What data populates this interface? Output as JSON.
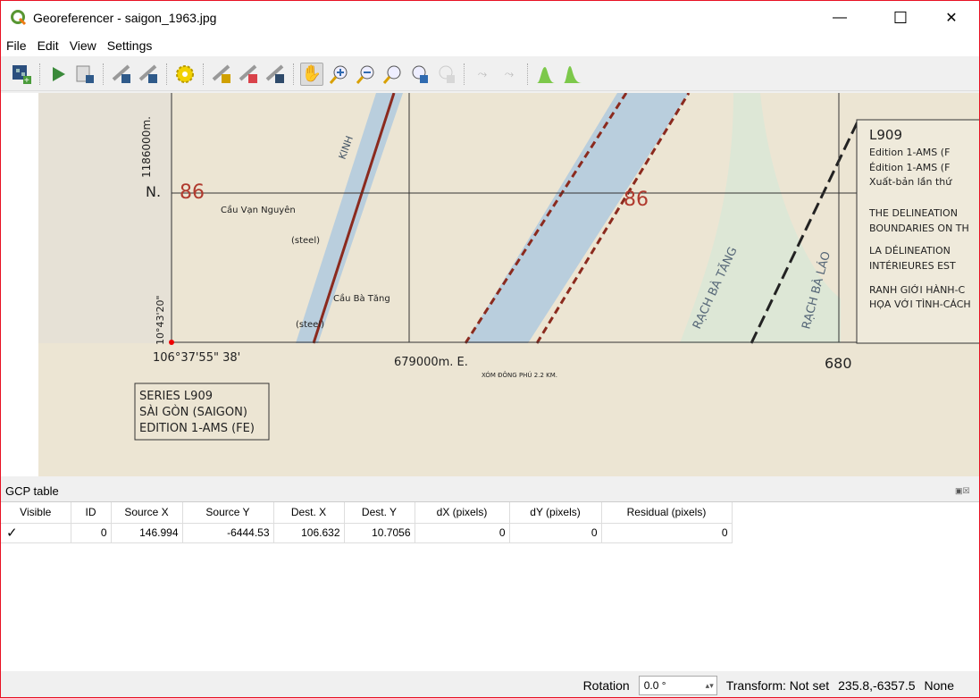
{
  "window": {
    "title": "Georeferencer - saigon_1963.jpg",
    "minimize": "—",
    "maximize": "☐",
    "close": "✕"
  },
  "menu": [
    "File",
    "Edit",
    "View",
    "Settings"
  ],
  "toolbar": [
    "open-raster",
    "start-georeferencing",
    "generate-gdal-script",
    "load-gcp-points",
    "save-gcp-points",
    "transformation-settings",
    "add-point",
    "delete-point",
    "move-gcp-point",
    "pan",
    "zoom-in",
    "zoom-out",
    "zoom-to-layer",
    "zoom-last",
    "zoom-next",
    "link-georeferencer-to-qgis",
    "link-qgis-to-georeferencer",
    "full-histogram-stretch",
    "local-histogram-stretch"
  ],
  "map": {
    "labels": [
      "86",
      "86",
      "N.",
      "Cầu Vạn Nguyên",
      "(steel)",
      "Cầu Bà Tăng",
      "(steel)",
      "10°43'20\"",
      "1186000m.",
      "106°37'55\" 38'",
      "679000m. E.",
      "680",
      "XÓM ĐÔNG PHÚ 2.2 KM.",
      "KINH",
      "RẠCH BÀ TĂNG",
      "RẠCH BÀ LÁO"
    ],
    "legend_box": [
      "SERIES L909",
      "SÀI GÒN (SAIGON)",
      "EDITION 1-AMS (FE)"
    ],
    "info_box": [
      "L909",
      "Edition 1-AMS (F",
      "Édition 1-AMS (F",
      "Xuất-bản lần thứ",
      "THE DELINEATION",
      "BOUNDARIES ON TH",
      "LA DÉLINEATION",
      "INTÉRIEURES EST",
      "RANH GIỚI HÀNH-C",
      "HỌA VỚI TÌNH-CÁCH"
    ]
  },
  "gcp": {
    "title": "GCP table",
    "columns": [
      "Visible",
      "ID",
      "Source X",
      "Source Y",
      "Dest. X",
      "Dest. Y",
      "dX (pixels)",
      "dY (pixels)",
      "Residual (pixels)"
    ],
    "rows": [
      {
        "visible": "✓",
        "id": "0",
        "source_x": "146.994",
        "source_y": "-6444.53",
        "dest_x": "106.632",
        "dest_y": "10.7056",
        "dx": "0",
        "dy": "0",
        "residual": "0"
      }
    ]
  },
  "status": {
    "rotation_label": "Rotation",
    "rotation_value": "0.0 °",
    "transform": "Transform: Not set",
    "coords": "235.8,-6357.5",
    "crs": "None"
  }
}
